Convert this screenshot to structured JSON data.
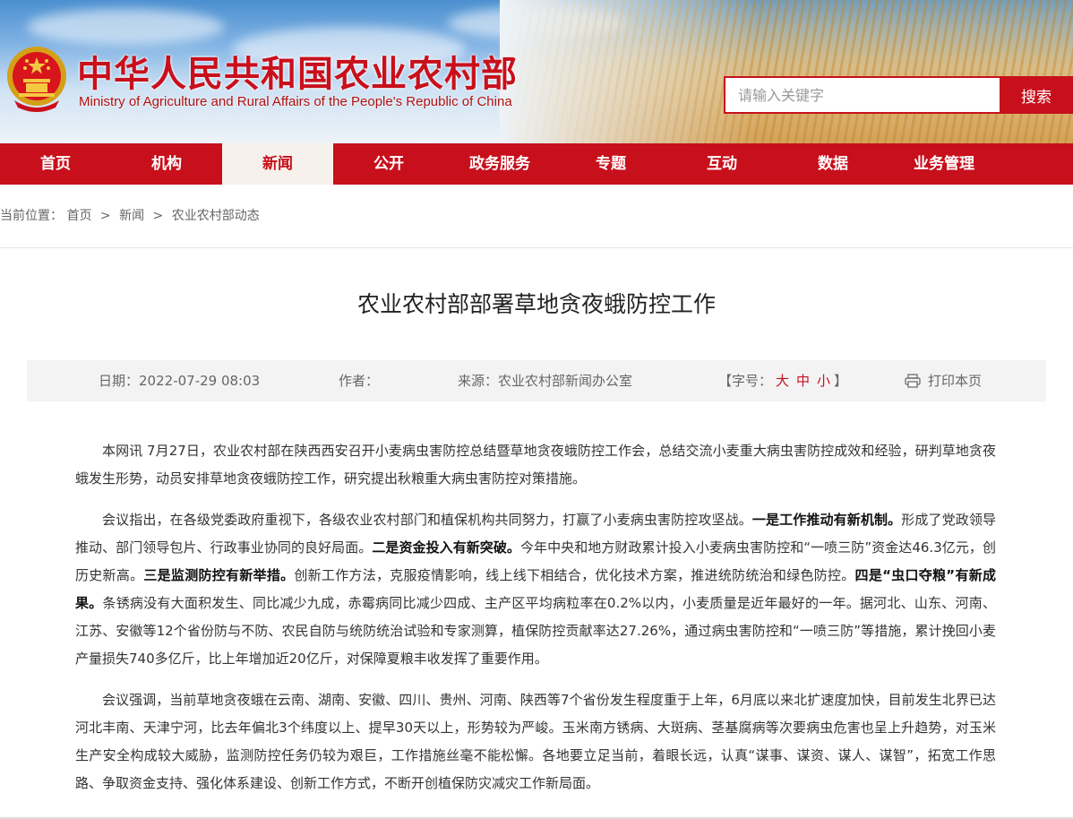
{
  "header": {
    "title": "中华人民共和国农业农村部",
    "subtitle": "Ministry of Agriculture and Rural Affairs of the People's Republic of China",
    "search_placeholder": "请输入关键字",
    "search_button": "搜索"
  },
  "nav": {
    "items": [
      "首页",
      "机构",
      "新闻",
      "公开",
      "政务服务",
      "专题",
      "互动",
      "数据",
      "业务管理"
    ],
    "active": "新闻"
  },
  "breadcrumb": {
    "prefix": "当前位置：",
    "items": [
      "首页",
      "新闻",
      "农业农村部动态"
    ],
    "separator": ">"
  },
  "article": {
    "title": "农业农村部部署草地贪夜蛾防控工作",
    "meta": {
      "date_label": "日期：",
      "date": "2022-07-29 08:03",
      "author_label": "作者：",
      "author": "",
      "source_label": "来源：",
      "source": "农业农村部新闻办公室",
      "fontsize_open": "【字号：",
      "fontsize_large": "大",
      "fontsize_medium": "中",
      "fontsize_small": "小",
      "fontsize_close": "】",
      "print": "打印本页"
    },
    "paragraphs": {
      "p1": "本网讯 7月27日，农业农村部在陕西西安召开小麦病虫害防控总结暨草地贪夜蛾防控工作会，总结交流小麦重大病虫害防控成效和经验，研判草地贪夜蛾发生形势，动员安排草地贪夜蛾防控工作，研究提出秋粮重大病虫害防控对策措施。",
      "p2a": "会议指出，在各级党委政府重视下，各级农业农村部门和植保机构共同努力，打赢了小麦病虫害防控攻坚战。",
      "p2b": "一是工作推动有新机制。",
      "p2c": "形成了党政领导推动、部门领导包片、行政事业协同的良好局面。",
      "p2d": "二是资金投入有新突破。",
      "p2e": "今年中央和地方财政累计投入小麦病虫害防控和“一喷三防”资金达46.3亿元，创历史新高。",
      "p2f": "三是监测防控有新举措。",
      "p2g": "创新工作方法，克服疫情影响，线上线下相结合，优化技术方案，推进统防统治和绿色防控。",
      "p2h": "四是“虫口夺粮”有新成果。",
      "p2i": "条锈病没有大面积发生、同比减少九成，赤霉病同比减少四成、主产区平均病粒率在0.2%以内，小麦质量是近年最好的一年。据河北、山东、河南、江苏、安徽等12个省份防与不防、农民自防与统防统治试验和专家测算，植保防控贡献率达27.26%，通过病虫害防控和“一喷三防”等措施，累计挽回小麦产量损失740多亿斤，比上年增加近20亿斤，对保障夏粮丰收发挥了重要作用。",
      "p3": "会议强调，当前草地贪夜蛾在云南、湖南、安徽、四川、贵州、河南、陕西等7个省份发生程度重于上年，6月底以来北扩速度加快，目前发生北界已达河北丰南、天津宁河，比去年偏北3个纬度以上、提早30天以上，形势较为严峻。玉米南方锈病、大斑病、茎基腐病等次要病虫危害也呈上升趋势，对玉米生产安全构成较大威胁，监测防控任务仍较为艰巨，工作措施丝毫不能松懈。各地要立足当前，着眼长远，认真“谋事、谋资、谋人、谋智”，拓宽工作思路、争取资金支持、强化体系建设、创新工作方式，不断开创植保防灾减灾工作新局面。"
    }
  },
  "colors": {
    "brand_red": "#c8101c",
    "nav_active_bg": "#f6f1ec",
    "meta_bg": "#f3f3f3"
  },
  "icons": [
    "national-emblem-icon",
    "printer-icon"
  ]
}
